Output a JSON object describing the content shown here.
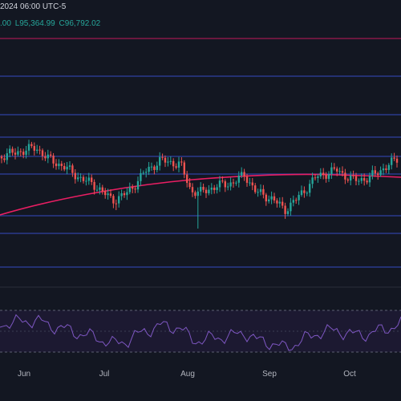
{
  "header": {
    "timestamp": "2024 06:00 UTC-5",
    "ohlc_fragment": ".00",
    "low_label": "L95,364.99",
    "close_label": "C96,792.02"
  },
  "x_axis": {
    "tick_labels": [
      "Jun",
      "Jul",
      "Aug",
      "Sep",
      "Oct"
    ]
  },
  "colors": {
    "background": "#131722",
    "up_candle": "#26a69a",
    "down_candle": "#ef5350",
    "level_line": "#2b3a8c",
    "moving_average": "#e91e63",
    "resistance_line": "#c2185b",
    "rsi_line": "#7e57c2",
    "rsi_band": "#1e1a33",
    "header_value": "#26a69a"
  },
  "chart_data": {
    "type": "candlestick",
    "horizontal_levels": 9,
    "indicators": [
      "moving-average",
      "rsi"
    ],
    "x_ticks": [
      "Jun",
      "Jul",
      "Aug",
      "Sep",
      "Oct"
    ]
  }
}
